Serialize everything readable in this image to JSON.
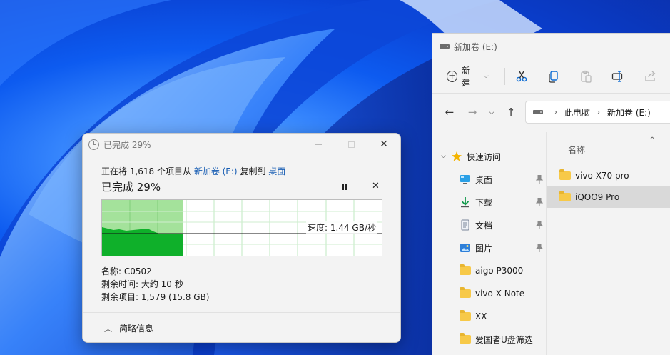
{
  "explorer": {
    "title": "新加卷 (E:)",
    "toolbar": {
      "new_label": "新建"
    },
    "breadcrumb": [
      "此电脑",
      "新加卷 (E:)"
    ],
    "nav": {
      "quick_access": "快速访问",
      "items": [
        {
          "label": "桌面",
          "icon": "desktop-icon",
          "pinned": true
        },
        {
          "label": "下载",
          "icon": "download-icon",
          "pinned": true
        },
        {
          "label": "文档",
          "icon": "document-icon",
          "pinned": true
        },
        {
          "label": "图片",
          "icon": "pictures-icon",
          "pinned": true
        },
        {
          "label": "aigo P3000",
          "icon": "folder-icon",
          "pinned": false
        },
        {
          "label": "vivo X Note",
          "icon": "folder-icon",
          "pinned": false
        },
        {
          "label": "XX",
          "icon": "folder-icon",
          "pinned": false
        },
        {
          "label": "爱国者U盘筛选",
          "icon": "folder-icon",
          "pinned": false
        }
      ]
    },
    "column_header": "名称",
    "files": [
      {
        "name": "vivo X70 pro",
        "selected": false
      },
      {
        "name": "iQOO9 Pro",
        "selected": true
      }
    ]
  },
  "dialog": {
    "title": "已完成 29%",
    "description": {
      "prefix": "正在将 1,618 个项目从 ",
      "source": "新加卷 (E:)",
      "middle": " 复制到 ",
      "dest": "桌面"
    },
    "progress_text": "已完成 29%",
    "progress_percent": 29,
    "speed": "速度: 1.44 GB/秒",
    "info": {
      "name": "名称: C0502",
      "time_left": "剩余时间: 大约 10 秒",
      "items_left": "剩余项目: 1,579 (15.8 GB)"
    },
    "footer_label": "简略信息"
  },
  "colors": {
    "graph_fill": "#0fb02a",
    "graph_bg_done": "#a4e29b",
    "link": "#1a5fb4",
    "selection": "#d9d9d9"
  }
}
